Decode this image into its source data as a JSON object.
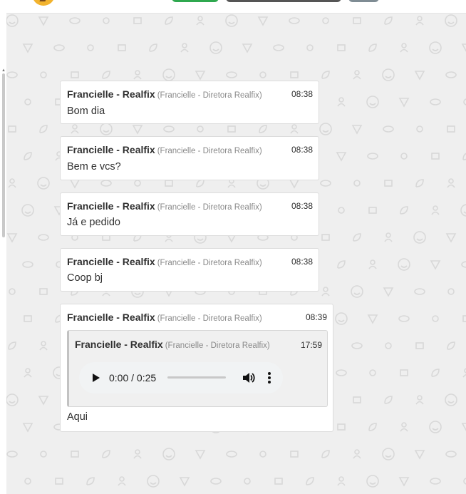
{
  "colors": {
    "chat_background": "#efefef",
    "bubble_background": "#ffffff",
    "quote_background": "#f0f0f0",
    "pattern_icon": "#d8d8d8",
    "header_button_green": "#2fa84f",
    "header_button_dark": "#555555",
    "header_button_gray": "#7f8c94"
  },
  "header": {
    "avatar_icon": "user-avatar-icon"
  },
  "messages": [
    {
      "sender": "Francielle - Realfix",
      "detail": "(Francielle - Diretora Realfix)",
      "time": "08:38",
      "text": "Bom dia"
    },
    {
      "sender": "Francielle - Realfix",
      "detail": "(Francielle - Diretora Realfix)",
      "time": "08:38",
      "text": "Bem e vcs?"
    },
    {
      "sender": "Francielle - Realfix",
      "detail": "(Francielle - Diretora Realfix)",
      "time": "08:38",
      "text": "Já e pedido"
    },
    {
      "sender": "Francielle - Realfix",
      "detail": "(Francielle - Diretora Realfix)",
      "time": "08:38",
      "text": "Coop bj"
    },
    {
      "sender": "Francielle - Realfix",
      "detail": "(Francielle - Diretora Realfix)",
      "time": "08:39",
      "text": "Aqui",
      "quoted": {
        "sender": "Francielle - Realfix",
        "detail": "(Francielle - Diretora Realfix)",
        "time": "17:59",
        "audio": {
          "time_display": "0:00 / 0:25",
          "progress": 0
        }
      }
    }
  ],
  "icons": {
    "play": "play-icon",
    "volume": "volume-icon",
    "more": "more-options-icon"
  }
}
